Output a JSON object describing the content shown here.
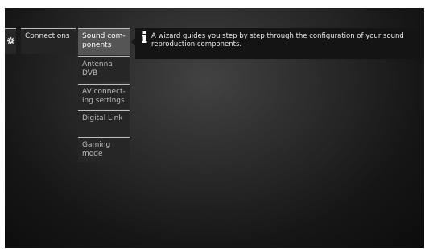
{
  "menu": {
    "settings_icon": "gear-icon",
    "main_item": "Connections",
    "submenu": [
      {
        "label": "Sound com-\nponents",
        "selected": true
      },
      {
        "label": "Antenna\nDVB",
        "selected": false
      },
      {
        "label": "AV connect-\ning settings",
        "selected": false
      },
      {
        "label": "Digital Link",
        "selected": false
      },
      {
        "label": "Gaming\nmode",
        "selected": false
      }
    ]
  },
  "info": {
    "icon": "info-icon",
    "text": "A wizard guides you step by step through the configuration of your sound reproduction components."
  }
}
